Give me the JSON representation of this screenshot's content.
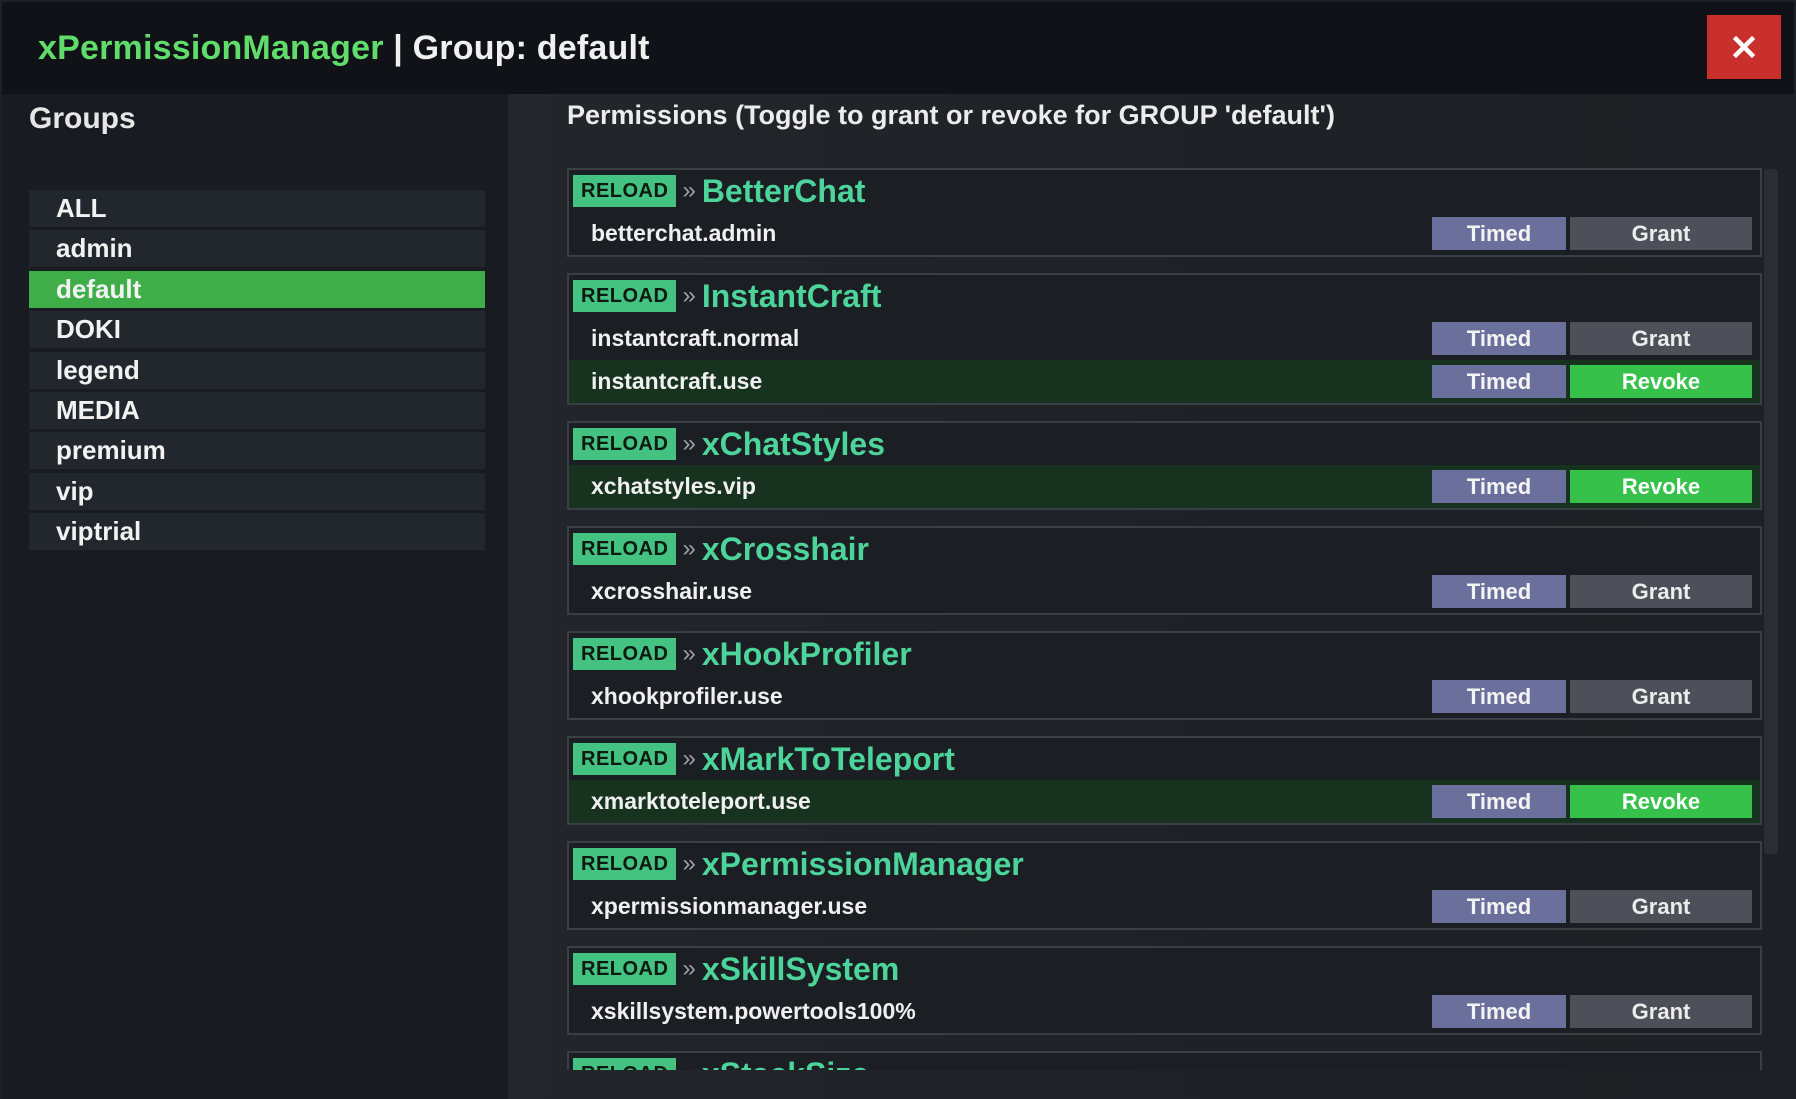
{
  "window": {
    "title_accent": "xPermissionManager",
    "title_rest": " | Group: default",
    "colors": {
      "accent": "#5fdc6a",
      "close": "#c9302c",
      "reload": "#43c281",
      "revoke": "#35c14a",
      "timed": "#6b6f9c",
      "grant": "#4d5058"
    }
  },
  "sidebar": {
    "title": "Groups",
    "groups": [
      {
        "label": "ALL",
        "active": false
      },
      {
        "label": "admin",
        "active": false
      },
      {
        "label": "default",
        "active": true
      },
      {
        "label": "DOKI",
        "active": false
      },
      {
        "label": "legend",
        "active": false
      },
      {
        "label": "MEDIA",
        "active": false
      },
      {
        "label": "premium",
        "active": false
      },
      {
        "label": "vip",
        "active": false
      },
      {
        "label": "viptrial",
        "active": false
      }
    ]
  },
  "main": {
    "header": "Permissions (Toggle to grant or revoke for GROUP 'default')",
    "reload_label": "RELOAD",
    "separator": "»",
    "timed_label": "Timed",
    "grant_label": "Grant",
    "revoke_label": "Revoke",
    "plugins": [
      {
        "name": "BetterChat",
        "perms": [
          {
            "name": "betterchat.admin",
            "granted": false
          }
        ]
      },
      {
        "name": "InstantCraft",
        "perms": [
          {
            "name": "instantcraft.normal",
            "granted": false
          },
          {
            "name": "instantcraft.use",
            "granted": true
          }
        ]
      },
      {
        "name": "xChatStyles",
        "perms": [
          {
            "name": "xchatstyles.vip",
            "granted": true
          }
        ]
      },
      {
        "name": "xCrosshair",
        "perms": [
          {
            "name": "xcrosshair.use",
            "granted": false
          }
        ]
      },
      {
        "name": "xHookProfiler",
        "perms": [
          {
            "name": "xhookprofiler.use",
            "granted": false
          }
        ]
      },
      {
        "name": "xMarkToTeleport",
        "perms": [
          {
            "name": "xmarktoteleport.use",
            "granted": true
          }
        ]
      },
      {
        "name": "xPermissionManager",
        "perms": [
          {
            "name": "xpermissionmanager.use",
            "granted": false
          }
        ]
      },
      {
        "name": "xSkillSystem",
        "perms": [
          {
            "name": "xskillsystem.powertools100%",
            "granted": false
          }
        ]
      },
      {
        "name": "xStackSize",
        "perms": []
      }
    ]
  }
}
